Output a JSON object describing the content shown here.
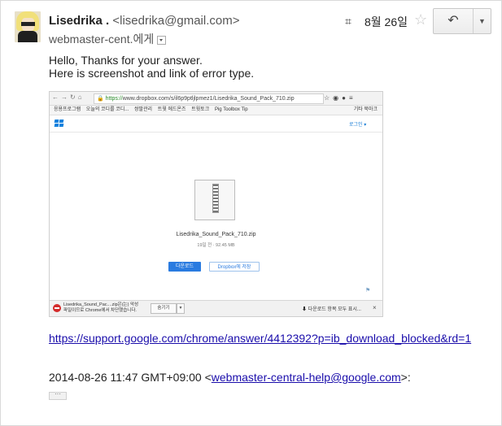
{
  "sender": {
    "name": "Lisedrika .",
    "email": "<lisedrika@gmail.com>"
  },
  "recipient": "webmaster-cent.에게",
  "date": "8월 26일",
  "message": {
    "line1": "Hello, Thanks for your answer.",
    "line2": "Here is screenshot and link of error type."
  },
  "screenshot": {
    "url_https": "https://",
    "url_rest": "www.dropbox.com/s/il6p9ptljlpmez1/Lisedrika_Sound_Pack_710.zip",
    "bookmarks": [
      "응용프로그램",
      "오늘의 코디를 코디...",
      "쌍팔관리",
      "트윗 에드온즈",
      "트윗토크",
      "Pig Toolbox Tip"
    ],
    "bookmarks_other": "기타 북마크",
    "login_label": "로그인 ▾",
    "file_name": "Lisedrika_Sound_Pack_710.zip",
    "file_meta": "19일 전 · 92.45 MB",
    "download_label": "다운로드",
    "save_label": "Dropbox에 저장",
    "error_line1": "Lisedrika_Sound_Pac....zip은(는) 악성",
    "error_line2": "파일이므로 Chrome에서 차단했습니다.",
    "keep_label": "숨기기",
    "show_all_label": "다운로드 항목 모두 표시..."
  },
  "link": "https://support.google.com/chrome/answer/4412392?p=ib_download_blocked&rd=1",
  "quote": {
    "prefix": "2014-08-26 11:47 GMT+09:00 <",
    "email": "webmaster-central-help@google.com",
    "suffix": ">:"
  },
  "trimmed": "···"
}
